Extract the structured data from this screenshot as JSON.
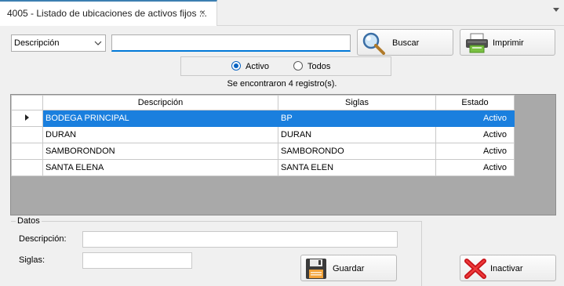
{
  "tab": {
    "title": "4005 - Listado de ubicaciones de activos fijos ::.",
    "close": "×"
  },
  "filter": {
    "field": "Descripción",
    "search_value": ""
  },
  "toolbar": {
    "search_label": "Buscar",
    "print_label": "Imprimir"
  },
  "status_filter": {
    "options": [
      "Activo",
      "Todos"
    ],
    "selected": "Activo"
  },
  "result_count": "Se encontraron 4 registro(s).",
  "grid": {
    "columns": [
      "Descripción",
      "Siglas",
      "Estado"
    ],
    "rows": [
      {
        "descripcion": "BODEGA PRINCIPAL",
        "siglas": "BP",
        "estado": "Activo"
      },
      {
        "descripcion": "DURAN",
        "siglas": "DURAN",
        "estado": "Activo"
      },
      {
        "descripcion": "SAMBORONDON",
        "siglas": "SAMBORONDO",
        "estado": "Activo"
      },
      {
        "descripcion": "SANTA ELENA",
        "siglas": "SANTA ELEN",
        "estado": "Activo"
      }
    ],
    "selected_row": 0
  },
  "datos": {
    "legend": "Datos",
    "descripcion_label": "Descripción:",
    "descripcion_value": "",
    "siglas_label": "Siglas:",
    "siglas_value": "",
    "save_label": "Guardar",
    "deactivate_label": "Inactivar"
  },
  "colors": {
    "selection": "#1a7fde",
    "accent": "#0078d7",
    "grid_bg": "#a9a9a9"
  }
}
